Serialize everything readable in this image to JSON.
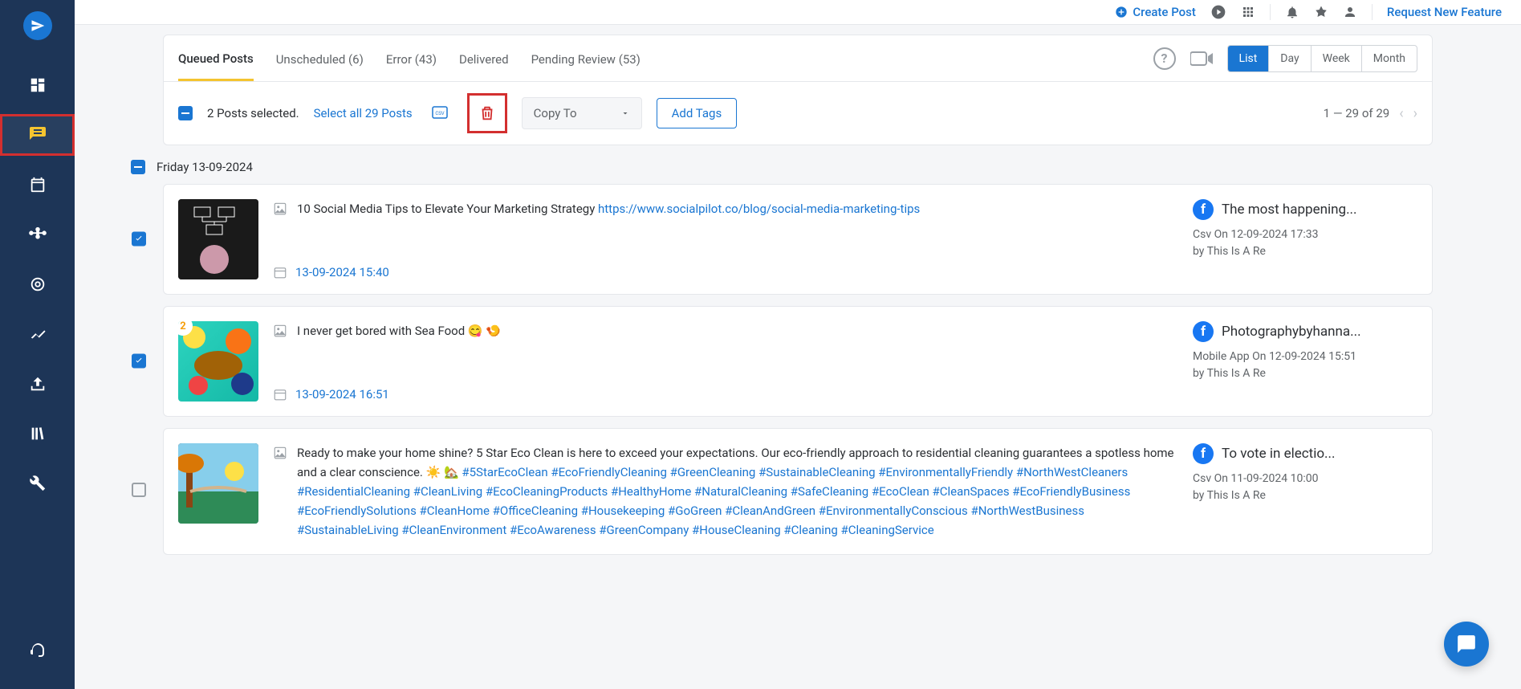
{
  "topbar": {
    "create_post": "Create Post",
    "request_feature": "Request New Feature"
  },
  "tabs": [
    {
      "label": "Queued Posts"
    },
    {
      "label": "Unscheduled",
      "count": "(6)"
    },
    {
      "label": "Error",
      "count": "(43)"
    },
    {
      "label": "Delivered"
    },
    {
      "label": "Pending Review",
      "count": "(53)"
    }
  ],
  "view_switch": [
    "List",
    "Day",
    "Week",
    "Month"
  ],
  "actionbar": {
    "selected_text": "2 Posts selected.",
    "select_all": "Select all 29 Posts",
    "copy_to": "Copy To",
    "add_tags": "Add Tags",
    "pagination": "1 — 29 of 29"
  },
  "date_header": "Friday 13-09-2024",
  "posts": [
    {
      "text": "10 Social Media Tips to Elevate Your Marketing Strategy ",
      "url": "https://www.socialpilot.co/blog/social-media-marketing-tips",
      "schedule": "13-09-2024 15:40",
      "account": "The most happening...",
      "source": "Csv On 12-09-2024 17:33",
      "by": "by This Is A Re",
      "checked": true
    },
    {
      "text": "I never get bored with Sea Food 😋 🍤",
      "schedule": "13-09-2024 16:51",
      "account": "Photographybyhanna...",
      "source": "Mobile App On 12-09-2024 15:51",
      "by": "by This Is A Re",
      "badge": "2",
      "checked": true
    },
    {
      "text_pre": "Ready to make your home shine? 5 Star Eco Clean is here to exceed your expectations. Our eco-friendly approach to residential cleaning guarantees a spotless home and a clear conscience. ☀️ 🏡 ",
      "hashtags": "#5StarEcoClean #EcoFriendlyCleaning #GreenCleaning #SustainableCleaning #EnvironmentallyFriendly #NorthWestCleaners #ResidentialCleaning #CleanLiving #EcoCleaningProducts #HealthyHome #NaturalCleaning #SafeCleaning #EcoClean #CleanSpaces #EcoFriendlyBusiness #EcoFriendlySolutions #CleanHome #OfficeCleaning #Housekeeping #GoGreen #CleanAndGreen #EnvironmentallyConscious #NorthWestBusiness #SustainableLiving #CleanEnvironment #EcoAwareness #GreenCompany #HouseCleaning #Cleaning #CleaningService",
      "account": "To vote in electio...",
      "source": "Csv On 11-09-2024 10:00",
      "by": "by This Is A Re",
      "checked": false
    }
  ]
}
